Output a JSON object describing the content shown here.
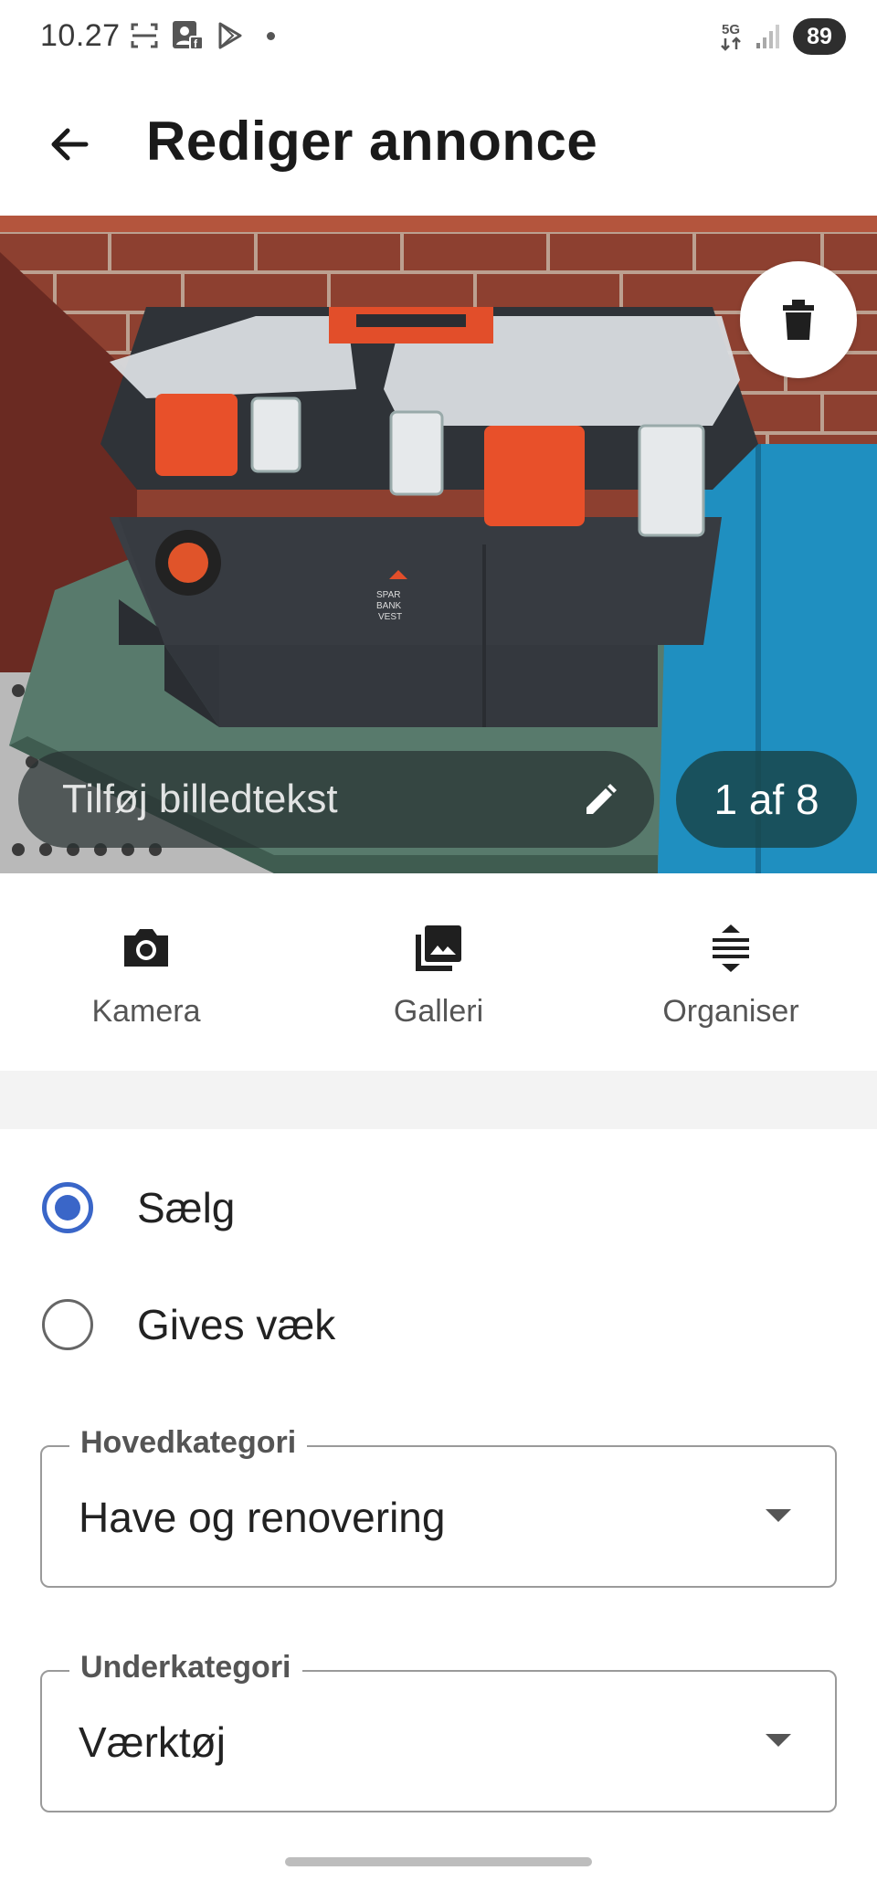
{
  "status_bar": {
    "time": "10.27",
    "network_label": "5G",
    "battery": "89"
  },
  "app_bar": {
    "title": "Rediger annonce"
  },
  "photo": {
    "caption_placeholder": "Tilføj billedtekst",
    "counter": "1 af 8",
    "watermark": "SPAR BANK VEST"
  },
  "photo_actions": [
    {
      "label": "Kamera",
      "icon": "camera-icon"
    },
    {
      "label": "Galleri",
      "icon": "gallery-icon"
    },
    {
      "label": "Organiser",
      "icon": "reorder-icon"
    }
  ],
  "listing_type": {
    "options": [
      {
        "label": "Sælg",
        "selected": true
      },
      {
        "label": "Gives væk",
        "selected": false
      }
    ]
  },
  "main_category": {
    "label": "Hovedkategori",
    "value": "Have og renovering"
  },
  "sub_category": {
    "label": "Underkategori",
    "value": "Værktøj"
  },
  "colors": {
    "accent": "#3a66c8"
  }
}
